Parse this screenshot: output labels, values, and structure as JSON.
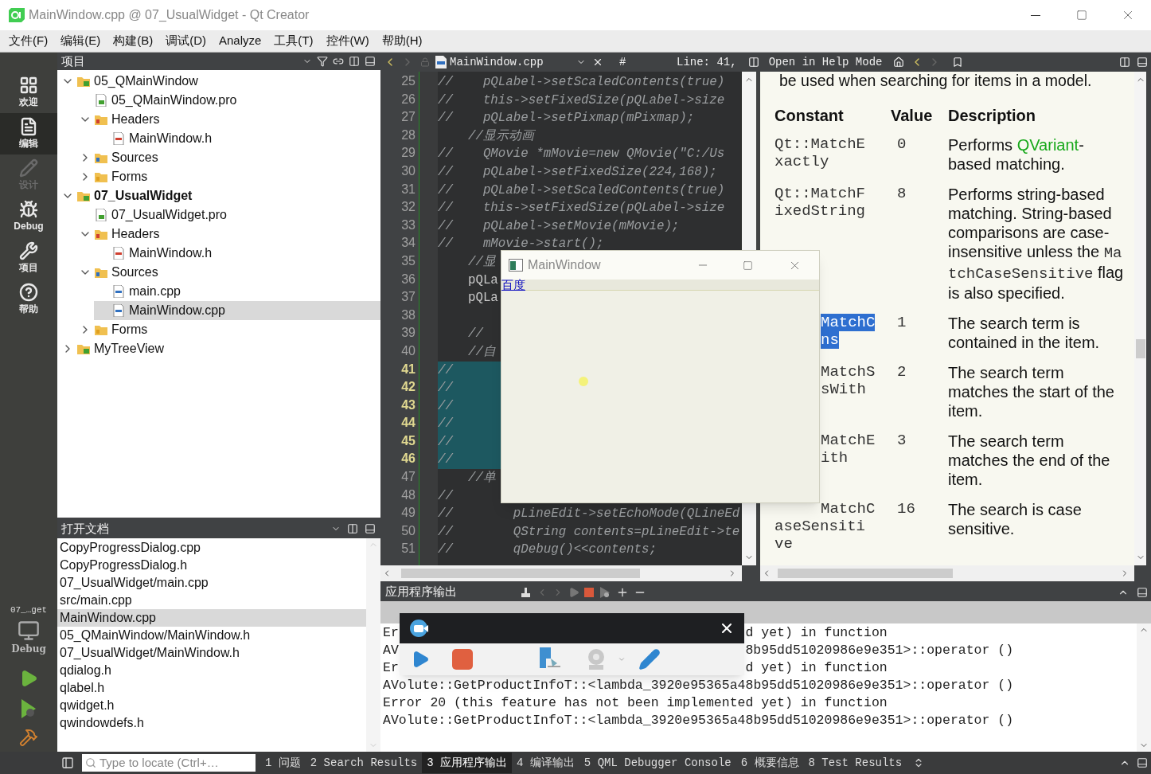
{
  "window": {
    "title": "MainWindow.cpp @ 07_UsualWidget - Qt Creator"
  },
  "menu": [
    "文件(F)",
    "编辑(E)",
    "构建(B)",
    "调试(D)",
    "Analyze",
    "工具(T)",
    "控件(W)",
    "帮助(H)"
  ],
  "modes": [
    {
      "label": "欢迎",
      "kind": "welcome",
      "selected": false,
      "disabled": false
    },
    {
      "label": "编辑",
      "kind": "edit",
      "selected": true,
      "disabled": false
    },
    {
      "label": "设计",
      "kind": "design",
      "selected": false,
      "disabled": true
    },
    {
      "label": "Debug",
      "kind": "debug",
      "selected": false,
      "disabled": false
    },
    {
      "label": "项目",
      "kind": "projects",
      "selected": false,
      "disabled": false
    },
    {
      "label": "帮助",
      "kind": "help",
      "selected": false,
      "disabled": false
    }
  ],
  "kit": {
    "project": "07_…get",
    "config": "Debug"
  },
  "projects": {
    "title": "项目",
    "tree": [
      {
        "label": "05_QMainWindow",
        "kind": "project",
        "active": false,
        "expanded": true,
        "selected": false,
        "children": [
          {
            "label": "05_QMainWindow.pro",
            "kind": "pro",
            "selected": false
          },
          {
            "label": "Headers",
            "kind": "headers",
            "expanded": true,
            "selected": false,
            "children": [
              {
                "label": "MainWindow.h",
                "kind": "header",
                "selected": false
              }
            ]
          },
          {
            "label": "Sources",
            "kind": "sources",
            "expanded": false,
            "selected": false
          },
          {
            "label": "Forms",
            "kind": "forms",
            "expanded": false,
            "selected": false
          }
        ]
      },
      {
        "label": "07_UsualWidget",
        "kind": "project",
        "active": true,
        "expanded": true,
        "selected": false,
        "children": [
          {
            "label": "07_UsualWidget.pro",
            "kind": "pro",
            "selected": false
          },
          {
            "label": "Headers",
            "kind": "headers",
            "expanded": true,
            "selected": false,
            "children": [
              {
                "label": "MainWindow.h",
                "kind": "header",
                "selected": false
              }
            ]
          },
          {
            "label": "Sources",
            "kind": "sources",
            "expanded": true,
            "selected": false,
            "children": [
              {
                "label": "main.cpp",
                "kind": "source",
                "selected": false
              },
              {
                "label": "MainWindow.cpp",
                "kind": "source",
                "selected": true
              }
            ]
          },
          {
            "label": "Forms",
            "kind": "forms",
            "expanded": false,
            "selected": false
          }
        ]
      },
      {
        "label": "MyTreeView",
        "kind": "project",
        "active": false,
        "expanded": false,
        "selected": false
      }
    ]
  },
  "open_documents": {
    "title": "打开文档",
    "items": [
      {
        "label": "CopyProgressDialog.cpp",
        "selected": false
      },
      {
        "label": "CopyProgressDialog.h",
        "selected": false
      },
      {
        "label": "07_UsualWidget/main.cpp",
        "selected": false
      },
      {
        "label": "src/main.cpp",
        "selected": false
      },
      {
        "label": "MainWindow.cpp",
        "selected": true
      },
      {
        "label": "05_QMainWindow/MainWindow.h",
        "selected": false
      },
      {
        "label": "07_UsualWidget/MainWindow.h",
        "selected": false
      },
      {
        "label": "qdialog.h",
        "selected": false
      },
      {
        "label": "qlabel.h",
        "selected": false
      },
      {
        "label": "qwidget.h",
        "selected": false
      },
      {
        "label": "qwindowdefs.h",
        "selected": false
      }
    ]
  },
  "editor": {
    "file": "MainWindow.cpp",
    "symbol": "#",
    "position": "Line: 41,",
    "help_mode": "Open in Help Mode",
    "lines": [
      {
        "number": "25",
        "kind": "comment",
        "text": "//    pQLabel->setScaledContents(true)",
        "selected": false
      },
      {
        "number": "26",
        "kind": "comment",
        "text": "//    this->setFixedSize(pQLabel->size",
        "selected": false
      },
      {
        "number": "27",
        "kind": "comment",
        "text": "//    pQLabel->setPixmap(mPixmap);",
        "selected": false
      },
      {
        "number": "28",
        "kind": "comment",
        "text": "    //显示动画",
        "selected": false
      },
      {
        "number": "29",
        "kind": "comment",
        "text": "//    QMovie *mMovie=new QMovie(\"C:/Us",
        "selected": false
      },
      {
        "number": "30",
        "kind": "comment",
        "text": "//    pQLabel->setFixedSize(224,168);",
        "selected": false
      },
      {
        "number": "31",
        "kind": "comment",
        "text": "//    pQLabel->setScaledContents(true)",
        "selected": false
      },
      {
        "number": "32",
        "kind": "comment",
        "text": "//    this->setFixedSize(pQLabel->size",
        "selected": false
      },
      {
        "number": "33",
        "kind": "comment",
        "text": "//    pQLabel->setMovie(mMovie);",
        "selected": false
      },
      {
        "number": "34",
        "kind": "comment",
        "text": "//    mMovie->start();",
        "selected": false
      },
      {
        "number": "35",
        "kind": "comment",
        "text": "    //显",
        "selected": false
      },
      {
        "number": "36",
        "kind": "code",
        "text": "    pQLa",
        "selected": false
      },
      {
        "number": "37",
        "kind": "code",
        "text": "    pQLa",
        "selected": false
      },
      {
        "number": "38",
        "kind": "blank",
        "selected": false
      },
      {
        "number": "39",
        "kind": "comment",
        "text": "    //",
        "selected": false
      },
      {
        "number": "40",
        "kind": "comment",
        "text": "    //自",
        "selected": false
      },
      {
        "number": "41",
        "kind": "comment",
        "text": "//",
        "selected": true
      },
      {
        "number": "42",
        "kind": "comment",
        "text": "//",
        "selected": true
      },
      {
        "number": "43",
        "kind": "comment",
        "text": "//",
        "selected": true
      },
      {
        "number": "44",
        "kind": "comment",
        "text": "//",
        "selected": true
      },
      {
        "number": "45",
        "kind": "comment",
        "text": "//",
        "selected": true
      },
      {
        "number": "46",
        "kind": "comment",
        "text": "//",
        "selected": true
      },
      {
        "number": "47",
        "kind": "comment",
        "text": "    //单",
        "selected": false
      },
      {
        "number": "48",
        "kind": "comment",
        "text": "//",
        "selected": false
      },
      {
        "number": "49",
        "kind": "comment",
        "text": "//        pLineEdit->setEchoMode(QLineEd",
        "selected": false
      },
      {
        "number": "50",
        "kind": "comment",
        "text": "//        QString contents=pLineEdit->te",
        "selected": false
      },
      {
        "number": "51",
        "kind": "comment",
        "text": "//        qDebug()<<contents;",
        "selected": false
      }
    ]
  },
  "help": {
    "intro": "be used when searching for items in a model.",
    "columns": [
      "Constant",
      "Value",
      "Description"
    ],
    "rows": [
      {
        "constant": [
          "Qt::MatchE",
          "xactly"
        ],
        "highlighted": false,
        "value": "0",
        "description": [
          {
            "kind": "text",
            "text": "Performs "
          },
          {
            "kind": "link",
            "text": "QVariant"
          },
          {
            "kind": "text",
            "text": "-based matching."
          }
        ]
      },
      {
        "constant": [
          "Qt::MatchF",
          "ixedString"
        ],
        "highlighted": false,
        "value": "8",
        "description": [
          {
            "kind": "text",
            "text": "Performs string-based matching. String-based comparisons are case-insensitive unless the "
          },
          {
            "kind": "code",
            "text": "MatchCaseSensitive"
          },
          {
            "kind": "text",
            "text": " flag is also specified."
          }
        ]
      },
      {
        "constant": [
          "MatchC",
          "ns"
        ],
        "highlighted": true,
        "value": "1",
        "description": [
          {
            "kind": "text",
            "text": "The search term is contained in the item."
          }
        ]
      },
      {
        "constant": [
          "MatchS",
          "sWith"
        ],
        "highlighted": false,
        "value": "2",
        "description": [
          {
            "kind": "text",
            "text": "The search term matches the start of the item."
          }
        ]
      },
      {
        "constant": [
          "MatchE",
          "ith"
        ],
        "highlighted": false,
        "value": "3",
        "description": [
          {
            "kind": "text",
            "text": "The search term matches the end of the item."
          }
        ]
      },
      {
        "constant": [
          "MatchC",
          "aseSensiti",
          "ve"
        ],
        "highlighted": false,
        "value": "16",
        "description": [
          {
            "kind": "text",
            "text": "The search is case sensitive."
          }
        ]
      }
    ]
  },
  "app_window": {
    "title": "MainWindow",
    "link": "百度"
  },
  "output": {
    "title": "应用程序输出",
    "lines": [
      {
        "kind": "split",
        "left": "Er",
        "right": "d yet) in function"
      },
      {
        "kind": "split",
        "left": "AV",
        "right": "8b95dd51020986e9e351>::operator ()"
      },
      {
        "kind": "split",
        "left": "Er",
        "right": "d yet) in function"
      },
      {
        "kind": "full",
        "text": "AVolute::GetProductInfoT::<lambda_3920e95365a48b95dd51020986e9e351>::operator ()"
      },
      {
        "kind": "full",
        "text": "Error 20 (this feature has not been implemented yet) in function"
      },
      {
        "kind": "full",
        "text": "AVolute::GetProductInfoT::<lambda_3920e95365a48b95dd51020986e9e351>::operator ()"
      }
    ]
  },
  "locator": {
    "placeholder": "Type to locate (Ctrl+…"
  },
  "status_tabs": [
    {
      "label": "1 问题",
      "selected": false
    },
    {
      "label": "2 Search Results",
      "selected": false
    },
    {
      "label": "3 应用程序输出",
      "selected": true
    },
    {
      "label": "4 编译输出",
      "selected": false
    },
    {
      "label": "5 QML Debugger Console",
      "selected": false
    },
    {
      "label": "6 概要信息",
      "selected": false
    },
    {
      "label": "8 Test Results",
      "selected": false
    }
  ]
}
